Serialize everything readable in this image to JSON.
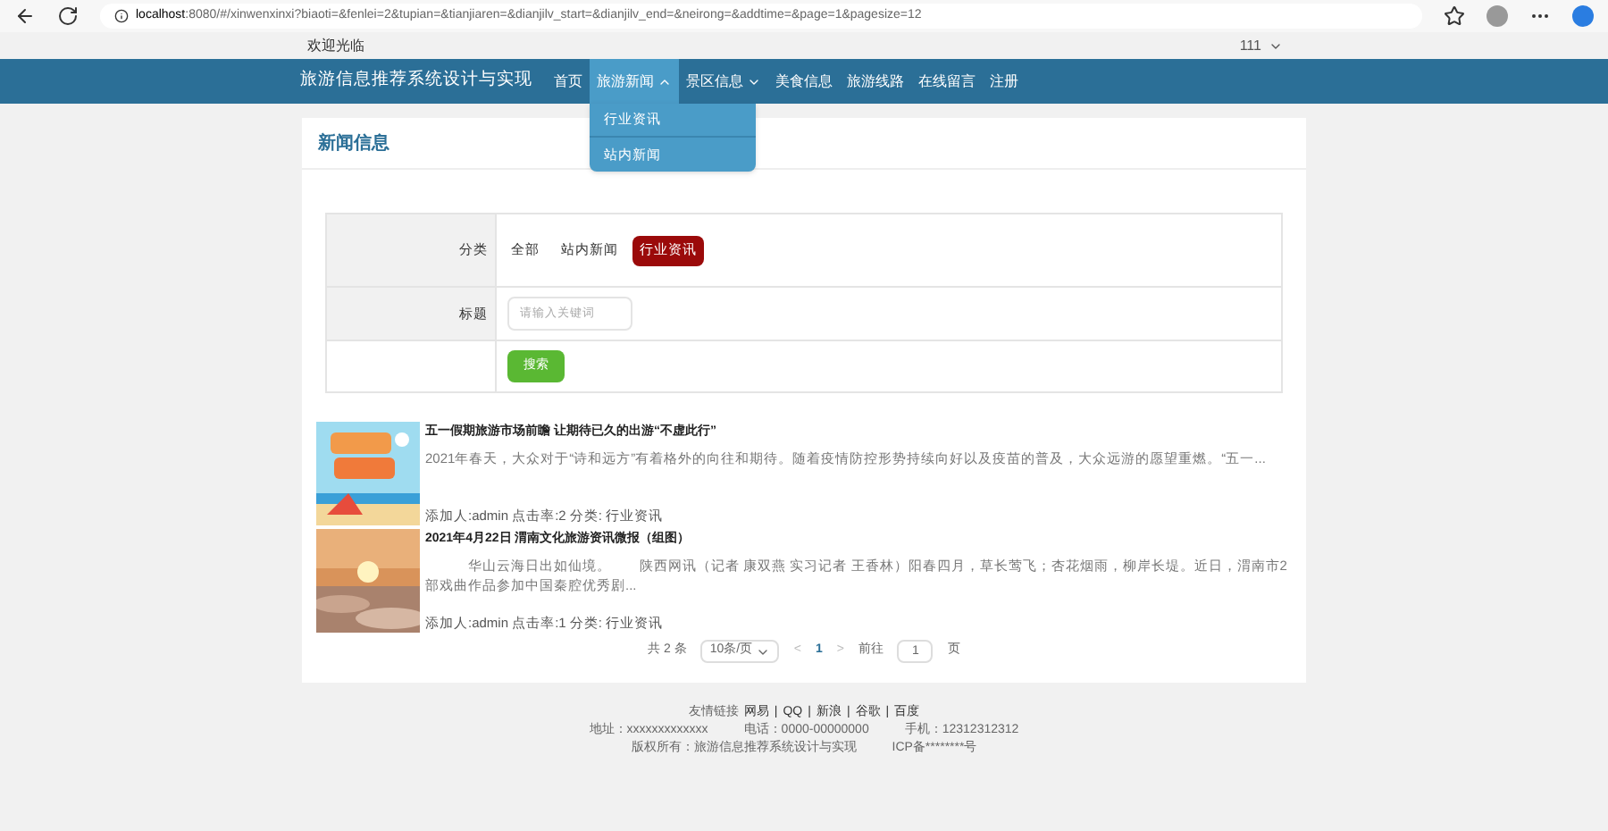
{
  "browser": {
    "url_host": "localhost",
    "url_rest": ":8080/#/xinwenxinxi?biaoti=&fenlei=2&tupian=&tianjiaren=&dianjilv_start=&dianjilv_end=&neirong=&addtime=&page=1&pagesize=12"
  },
  "topbar": {
    "welcome": "欢迎光临",
    "user": "111"
  },
  "nav": {
    "brand": "旅游信息推荐系统设计与实现",
    "items": [
      {
        "label": "首页",
        "selected": false,
        "has_menu": false
      },
      {
        "label": "旅游新闻",
        "selected": true,
        "has_menu": true,
        "expanded": true,
        "children": [
          "行业资讯",
          "站内新闻"
        ]
      },
      {
        "label": "景区信息",
        "selected": false,
        "has_menu": true,
        "expanded": false
      },
      {
        "label": "美食信息",
        "selected": false,
        "has_menu": false
      },
      {
        "label": "旅游线路",
        "selected": false,
        "has_menu": false
      },
      {
        "label": "在线留言",
        "selected": false,
        "has_menu": false
      },
      {
        "label": "注册",
        "selected": false,
        "has_menu": false
      }
    ]
  },
  "section_title": "新闻信息",
  "filter": {
    "category_label": "分类",
    "categories": [
      {
        "label": "全部",
        "selected": false
      },
      {
        "label": "站内新闻",
        "selected": false
      },
      {
        "label": "行业资讯",
        "selected": true
      }
    ],
    "title_label": "标题",
    "title_placeholder": "请输入关键词",
    "search_button": "搜索"
  },
  "news": [
    {
      "title": "五一假期旅游市场前瞻 让期待已久的出游“不虚此行”",
      "summary": "2021年春天，大众对于“诗和远方”有着格外的向往和期待。随着疫情防控形势持续向好以及疫苗的普及，大众远游的愿望重燃。“五一...",
      "meta": "添加人:admin  点击率:2  分类: 行业资讯"
    },
    {
      "title": "2021年4月22日 渭南文化旅游资讯微报（组图）",
      "summary": "　　　华山云海日出如仙境。　　陕西网讯（记者 康双燕 实习记者 王香林）阳春四月，草长莺飞；杏花烟雨，柳岸长堤。近日，渭南市2部戏曲作品参加中国秦腔优秀剧...",
      "meta": "添加人:admin  点击率:1  分类: 行业资讯"
    }
  ],
  "pagination": {
    "total": "共 2 条",
    "page_size": "10条/页",
    "prev": "<",
    "current": "1",
    "next": ">",
    "goto_label": "前往",
    "goto_value": "1",
    "goto_suffix": "页"
  },
  "footer": {
    "links_label": "友情链接",
    "links": [
      "网易",
      "QQ",
      "新浪",
      "谷歌",
      "百度"
    ],
    "link_separator": "|",
    "address": "地址：xxxxxxxxxxxxx",
    "phone": "电话：0000-00000000",
    "mobile": "手机：12312312312",
    "copyright": "版权所有：旅游信息推荐系统设计与实现",
    "icp": "ICP备********号"
  }
}
